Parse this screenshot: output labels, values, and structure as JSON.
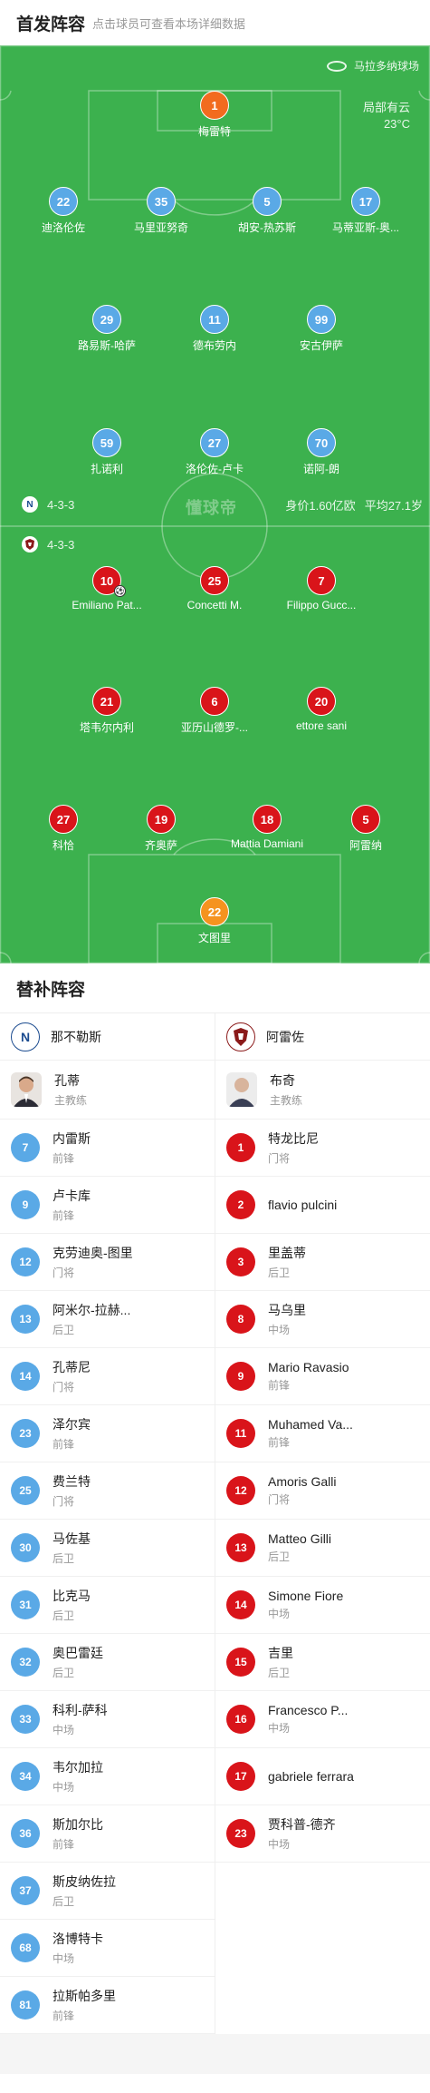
{
  "header": {
    "title": "首发阵容",
    "hint": "点击球员可查看本场详细数据"
  },
  "pitch": {
    "stadium": "马拉多纳球场",
    "weather_line1": "局部有云",
    "weather_line2": "23°C",
    "watermark": "懂球帝",
    "home_formation": "4-3-3",
    "away_formation": "4-3-3",
    "home_logo_text": "N",
    "value_label": "身价1.60亿欧",
    "age_label": "平均27.1岁"
  },
  "home_lineup": [
    {
      "num": "1",
      "name": "梅雷特",
      "gk": true
    },
    {
      "num": "22",
      "name": "迪洛伦佐"
    },
    {
      "num": "35",
      "name": "马里亚努奇"
    },
    {
      "num": "5",
      "name": "胡安-热苏斯"
    },
    {
      "num": "17",
      "name": "马蒂亚斯-奥..."
    },
    {
      "num": "29",
      "name": "路易斯-哈萨"
    },
    {
      "num": "11",
      "name": "德布劳内"
    },
    {
      "num": "99",
      "name": "安古伊萨"
    },
    {
      "num": "59",
      "name": "扎诺利"
    },
    {
      "num": "27",
      "name": "洛伦佐-卢卡"
    },
    {
      "num": "70",
      "name": "诺阿-朗"
    }
  ],
  "away_lineup": [
    {
      "num": "10",
      "name": "Emiliano Pat...",
      "goal": true
    },
    {
      "num": "25",
      "name": "Concetti M."
    },
    {
      "num": "7",
      "name": "Filippo Gucc..."
    },
    {
      "num": "21",
      "name": "塔韦尔内利"
    },
    {
      "num": "6",
      "name": "亚历山德罗-..."
    },
    {
      "num": "20",
      "name": "ettore sani"
    },
    {
      "num": "27",
      "name": "科恰"
    },
    {
      "num": "19",
      "name": "齐奥萨"
    },
    {
      "num": "18",
      "name": "Mattia Damiani"
    },
    {
      "num": "5",
      "name": "阿雷纳"
    },
    {
      "num": "22",
      "name": "文图里",
      "gk": true
    }
  ],
  "subs": {
    "title": "替补阵容",
    "home_team": "那不勒斯",
    "away_team": "阿雷佐",
    "home_coach": {
      "name": "孔蒂",
      "role": "主教练"
    },
    "away_coach": {
      "name": "布奇",
      "role": "主教练"
    },
    "home": [
      {
        "num": "7",
        "name": "内雷斯",
        "pos": "前锋"
      },
      {
        "num": "9",
        "name": "卢卡库",
        "pos": "前锋"
      },
      {
        "num": "12",
        "name": "克劳迪奥-图里",
        "pos": "门将"
      },
      {
        "num": "13",
        "name": "阿米尔-拉赫...",
        "pos": "后卫"
      },
      {
        "num": "14",
        "name": "孔蒂尼",
        "pos": "门将"
      },
      {
        "num": "23",
        "name": "泽尔宾",
        "pos": "前锋"
      },
      {
        "num": "25",
        "name": "费兰特",
        "pos": "门将"
      },
      {
        "num": "30",
        "name": "马佐基",
        "pos": "后卫"
      },
      {
        "num": "31",
        "name": "比克马",
        "pos": "后卫"
      },
      {
        "num": "32",
        "name": "奥巴雷廷",
        "pos": "后卫"
      },
      {
        "num": "33",
        "name": "科利-萨科",
        "pos": "中场"
      },
      {
        "num": "34",
        "name": "韦尔加拉",
        "pos": "中场"
      },
      {
        "num": "36",
        "name": "斯加尔比",
        "pos": "前锋"
      },
      {
        "num": "37",
        "name": "斯皮纳佐拉",
        "pos": "后卫"
      },
      {
        "num": "68",
        "name": "洛博特卡",
        "pos": "中场"
      },
      {
        "num": "81",
        "name": "拉斯帕多里",
        "pos": "前锋"
      }
    ],
    "away": [
      {
        "num": "1",
        "name": "特龙比尼",
        "pos": "门将"
      },
      {
        "num": "2",
        "name": "flavio pulcini",
        "pos": ""
      },
      {
        "num": "3",
        "name": "里盖蒂",
        "pos": "后卫"
      },
      {
        "num": "8",
        "name": "马乌里",
        "pos": "中场"
      },
      {
        "num": "9",
        "name": "Mario Ravasio",
        "pos": "前锋"
      },
      {
        "num": "11",
        "name": "Muhamed Va...",
        "pos": "前锋"
      },
      {
        "num": "12",
        "name": "Amoris Galli",
        "pos": "门将"
      },
      {
        "num": "13",
        "name": "Matteo Gilli",
        "pos": "后卫"
      },
      {
        "num": "14",
        "name": "Simone Fiore",
        "pos": "中场"
      },
      {
        "num": "15",
        "name": "吉里",
        "pos": "后卫"
      },
      {
        "num": "16",
        "name": "Francesco P...",
        "pos": "中场"
      },
      {
        "num": "17",
        "name": "gabriele ferrara",
        "pos": ""
      },
      {
        "num": "23",
        "name": "贾科普-德齐",
        "pos": "中场"
      }
    ]
  }
}
